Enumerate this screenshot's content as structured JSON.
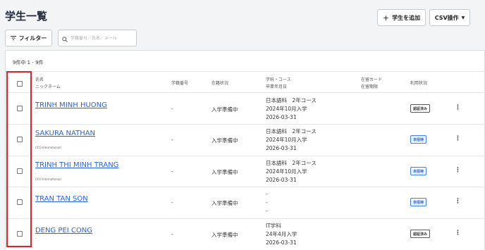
{
  "page": {
    "title": "学生一覧"
  },
  "toolbar": {
    "add_label": "学生を追加",
    "csv_label": "CSV操作",
    "filter_label": "フィルター",
    "search_placeholder": "学籍番号／氏名／メール"
  },
  "list": {
    "count_text": "9件中 1 - 9件",
    "headers": {
      "name_line1": "氏名",
      "name_line2": "ニックネーム",
      "student_no": "学籍番号",
      "status": "在籍状況",
      "course_line1": "学科・コース",
      "course_line2": "卒業年月日",
      "card_line1": "在留カード",
      "card_line2": "在留期限",
      "usage": "利用状況"
    },
    "rows": [
      {
        "name": "TRINH MINH HUONG",
        "nickname": "-",
        "org": "",
        "student_no": "-",
        "status": "入学準備中",
        "course": "日本語科　2年コース",
        "entry": "2024年10月入学",
        "graduation": "2026-03-31",
        "usage": "認証済み",
        "usage_color": "#333333"
      },
      {
        "name": "SAKURA NATHAN",
        "nickname": "-",
        "org": "(ICO International)",
        "student_no": "-",
        "status": "入学準備中",
        "course": "日本語科　2年コース",
        "entry": "2024年10月入学",
        "graduation": "2026-03-31",
        "usage": "未招待",
        "usage_color": "#2563eb"
      },
      {
        "name": "TRINH THI MINH TRANG",
        "nickname": "-",
        "org": "(ICO International)",
        "student_no": "-",
        "status": "入学準備中",
        "course": "日本語科　2年コース",
        "entry": "2024年10月入学",
        "graduation": "2026-03-31",
        "usage": "未招待",
        "usage_color": "#2563eb"
      },
      {
        "name": "TRAN TAN SON",
        "nickname": "-",
        "org": "",
        "student_no": "-",
        "status": "入学準備中",
        "course": "-",
        "entry": "-",
        "graduation": "-",
        "usage": "未招待",
        "usage_color": "#2563eb"
      },
      {
        "name": "DENG PEI CONG",
        "nickname": "-",
        "org": "",
        "student_no": "-",
        "status": "入学準備中",
        "course": "IT学科",
        "entry": "24年4月入学",
        "graduation": "2026-03-31",
        "usage": "認証済み",
        "usage_color": "#333333"
      }
    ]
  },
  "row_menu_label": "⋮",
  "icons": {
    "add": "plus-icon",
    "csv": "chevron-down-icon",
    "filter": "filter-icon",
    "search": "search-icon",
    "menu": "kebab-menu-icon"
  },
  "colors": {
    "link": "#2563eb",
    "highlight": "#e0202a"
  }
}
